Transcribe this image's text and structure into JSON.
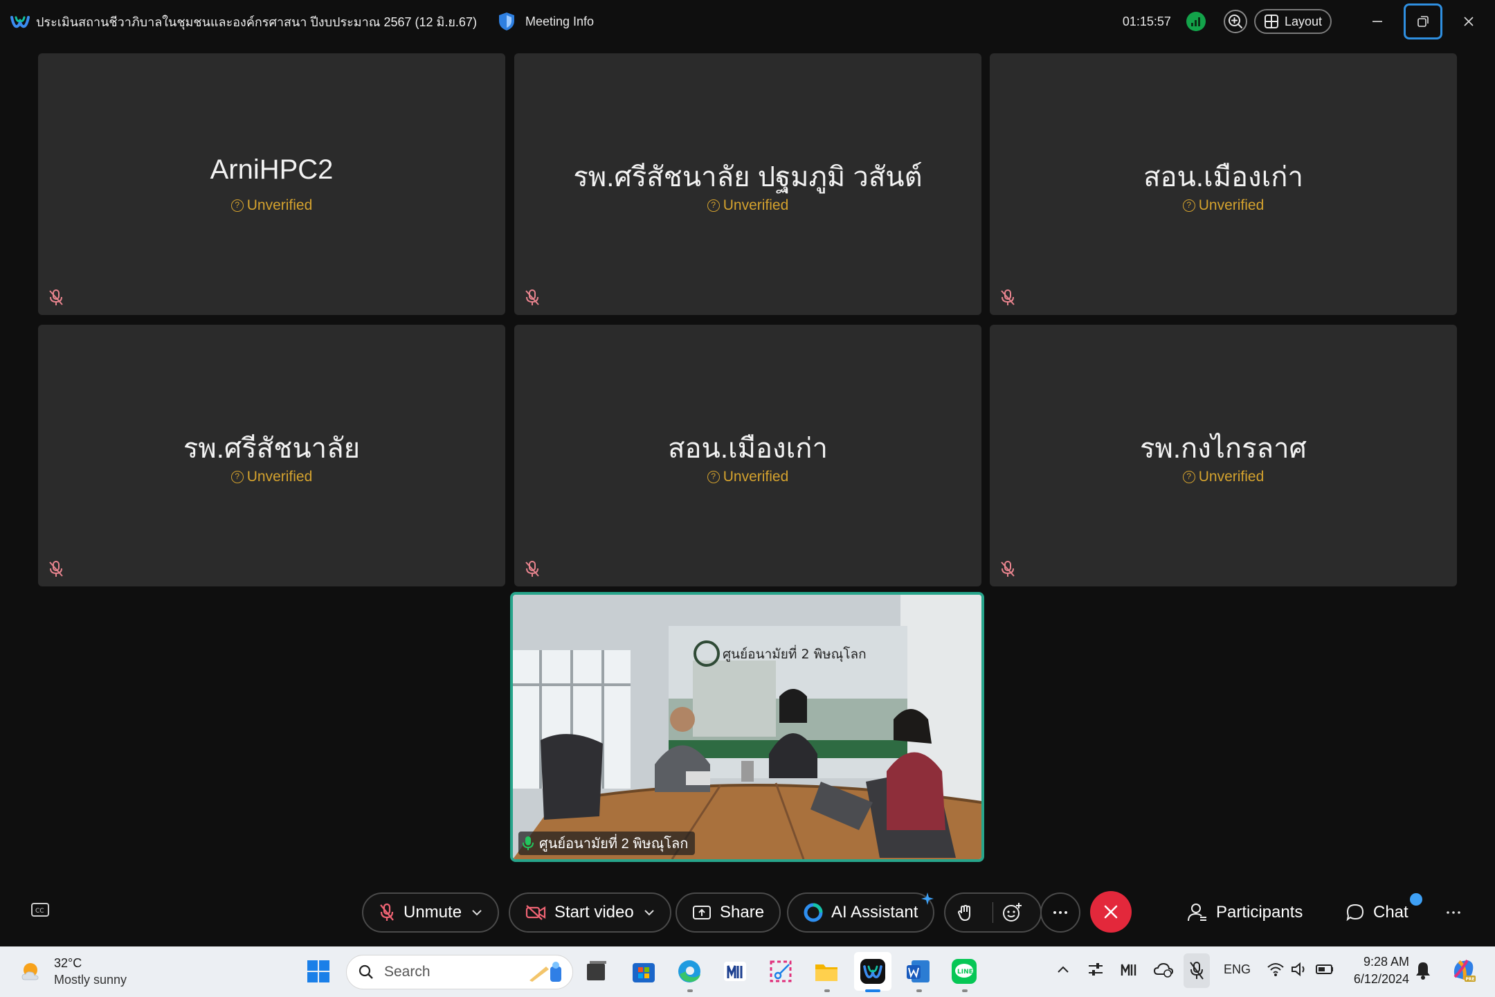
{
  "titlebar": {
    "title": "ประเมินสถานชีวาภิบาลในชุมชนและองค์กรศาสนา ปีงบประมาณ 2567 (12 มิ.ย.67)",
    "meeting_info": "Meeting Info",
    "timer": "01:15:57",
    "layout_label": "Layout"
  },
  "tiles": [
    {
      "name": "ArniHPC2",
      "status": "Unverified"
    },
    {
      "name": "รพ.ศรีสัชนาลัย ปฐมภูมิ วสันต์",
      "status": "Unverified"
    },
    {
      "name": "สอน.เมืองเก่า",
      "status": "Unverified"
    },
    {
      "name": "รพ.ศรีสัชนาลัย",
      "status": "Unverified"
    },
    {
      "name": "สอน.เมืองเก่า",
      "status": "Unverified"
    },
    {
      "name": "รพ.กงไกรลาศ",
      "status": "Unverified"
    }
  ],
  "video": {
    "participant_name": "ศูนย์อนามัยที่ 2 พิษณุโลก",
    "banner_title": "ศูนย์อนามัยที่ 2 พิษณุโลก"
  },
  "controls": {
    "unmute": "Unmute",
    "start_video": "Start video",
    "share": "Share",
    "ai_assistant": "AI Assistant",
    "participants": "Participants",
    "chat": "Chat"
  },
  "taskbar": {
    "temperature": "32°C",
    "condition": "Mostly sunny",
    "search_placeholder": "Search",
    "language": "ENG",
    "time": "9:28 AM",
    "date": "6/12/2024"
  },
  "colors": {
    "unverified": "#d4a22e",
    "end_call": "#e3283b",
    "speaker_border": "#27a58b",
    "signal": "#13a34a"
  }
}
